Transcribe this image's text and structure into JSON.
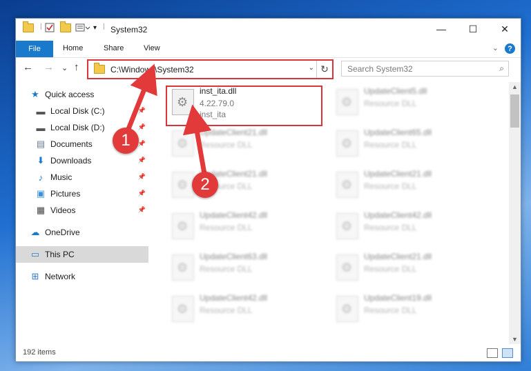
{
  "window": {
    "title": "System32",
    "minimize": "—",
    "maximize": "☐",
    "close": "✕"
  },
  "ribbon": {
    "file": "File",
    "home": "Home",
    "share": "Share",
    "view": "View",
    "help": "?",
    "collapse": "⌄"
  },
  "nav": {
    "back": "←",
    "forward": "→",
    "recent": "⌄",
    "up": "↑",
    "address": "C:\\Windows\\System32",
    "address_drop": "⌄",
    "refresh": "↻",
    "search_placeholder": "Search System32",
    "search_icon": "⌕"
  },
  "sidebar": {
    "items": [
      {
        "label": "Quick access",
        "icon": "★"
      },
      {
        "label": "Local Disk (C:)",
        "icon": "▬"
      },
      {
        "label": "Local Disk (D:)",
        "icon": "▬"
      },
      {
        "label": "Documents",
        "icon": "▤"
      },
      {
        "label": "Downloads",
        "icon": "⬇"
      },
      {
        "label": "Music",
        "icon": "♪"
      },
      {
        "label": "Pictures",
        "icon": "▣"
      },
      {
        "label": "Videos",
        "icon": "▦"
      },
      {
        "label": "OneDrive",
        "icon": "☁"
      },
      {
        "label": "This PC",
        "icon": "▭"
      },
      {
        "label": "Network",
        "icon": "⊞"
      }
    ],
    "pin": "📌"
  },
  "files": {
    "main": {
      "name": "inst_ita.dll",
      "version": "4.22.79.0",
      "desc": "inst_ita"
    },
    "blurred": [
      {
        "name": "UpdateClient5.dll",
        "desc": "Resource DLL"
      },
      {
        "name": "UpdateClient21.dll",
        "desc": "Resource DLL"
      },
      {
        "name": "UpdateClient65.dll",
        "desc": "Resource DLL"
      },
      {
        "name": "UpdateClient21.dll",
        "desc": "Resource DLL"
      },
      {
        "name": "UpdateClient21.dll",
        "desc": "Resource DLL"
      },
      {
        "name": "UpdateClient42.dll",
        "desc": "Resource DLL"
      },
      {
        "name": "UpdateClient42.dll",
        "desc": "Resource DLL"
      },
      {
        "name": "UpdateClient63.dll",
        "desc": "Resource DLL"
      },
      {
        "name": "UpdateClient21.dll",
        "desc": "Resource DLL"
      },
      {
        "name": "UpdateClient42.dll",
        "desc": "Resource DLL"
      },
      {
        "name": "UpdateClient19.dll",
        "desc": "Resource DLL"
      }
    ]
  },
  "status": {
    "count": "192 items"
  },
  "callouts": {
    "one": "1",
    "two": "2"
  },
  "colors": {
    "accent": "#1979ca",
    "highlight": "#d9343a"
  }
}
